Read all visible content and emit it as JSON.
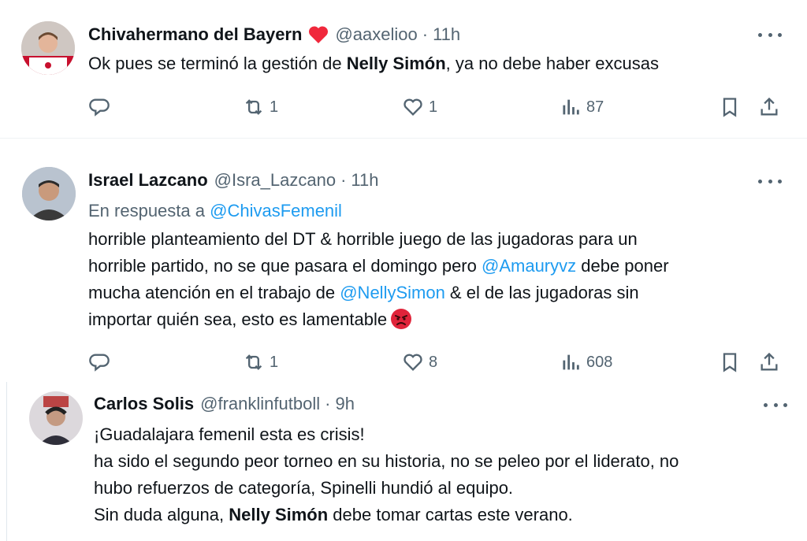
{
  "tweets": [
    {
      "name": "Chivahermano del Bayern",
      "handle": "@aaxelioo",
      "dot": "·",
      "time": "11h",
      "text": {
        "a": "Ok pues se terminó la gestión de ",
        "b": "Nelly Simón",
        "c": ", ya no debe haber excusas"
      },
      "counts": {
        "reply": "",
        "retweet": "1",
        "like": "1",
        "views": "87"
      }
    },
    {
      "name": "Israel Lazcano",
      "handle": "@Isra_Lazcano",
      "dot": "·",
      "time": "11h",
      "reply_prefix": "En respuesta a ",
      "reply_to": "@ChivasFemenil",
      "lines": [
        "horrible planteamiento del DT & horrible juego de las jugadoras para un",
        {
          "a": "horrible partido, no se que pasara el domingo pero ",
          "link": "@Amauryvz",
          "b": " debe poner"
        },
        {
          "a": "mucha atención en el trabajo de ",
          "link": "@NellySimon",
          "b": " & el de las jugadoras sin"
        },
        "importar quién sea, esto es lamentable"
      ],
      "counts": {
        "reply": "",
        "retweet": "1",
        "like": "8",
        "views": "608"
      }
    },
    {
      "name": "Carlos Solis",
      "handle": "@franklinfutboll",
      "dot": "·",
      "time": "9h",
      "lines": [
        "¡Guadalajara femenil esta es crisis!",
        "ha sido el segundo peor torneo en su historia, no se peleo por el liderato, no",
        "hubo refuerzos de categoría, Spinelli hundió al equipo.",
        {
          "a": "Sin duda alguna, ",
          "b": "Nelly Simón",
          "c": " debe tomar cartas este verano."
        }
      ]
    }
  ],
  "icons": {
    "reply": "reply-icon",
    "retweet": "retweet-icon",
    "like": "like-icon",
    "views": "views-icon",
    "bookmark": "bookmark-icon",
    "share": "share-icon",
    "more": "more-icon"
  },
  "colors": {
    "link": "#1d9bf0",
    "secondary": "#536471",
    "heart": "#f91880",
    "text": "#0f1419"
  }
}
